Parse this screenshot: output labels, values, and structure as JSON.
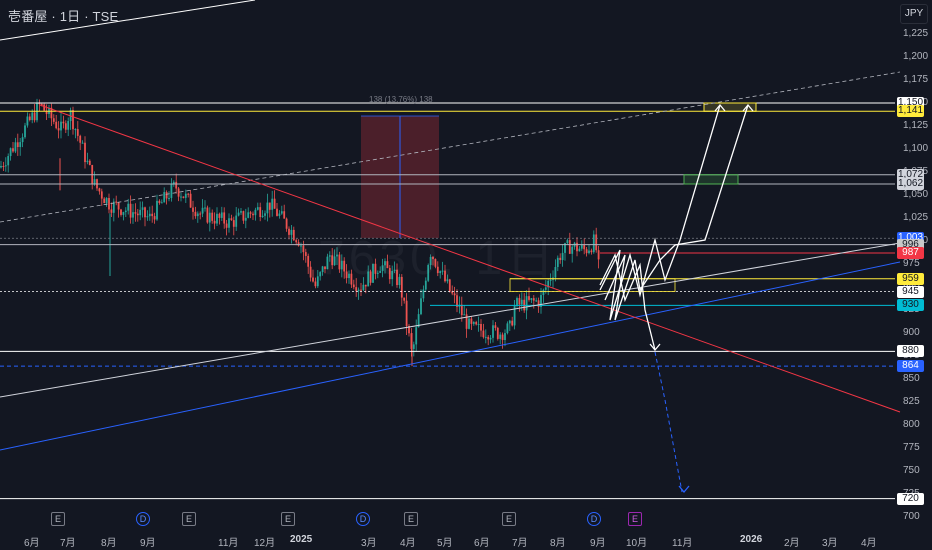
{
  "header": {
    "title": "壱番屋 · 1日 · TSE"
  },
  "currency": "JPY",
  "watermark": "7630, 1日",
  "measure_label": "138 (13.76%) 138",
  "price_axis": [
    "1,225",
    "1,200",
    "1,175",
    "1,150",
    "1,125",
    "1,100",
    "1,075",
    "1,050",
    "1,025",
    "1,000",
    "975",
    "950",
    "925",
    "900",
    "875",
    "850",
    "825",
    "800",
    "775",
    "750",
    "725",
    "700"
  ],
  "price_badges": [
    {
      "text": "1,150",
      "bg": "#ffffff",
      "fg": "#131722"
    },
    {
      "text": "1,141",
      "bg": "#ffeb3b",
      "fg": "#131722"
    },
    {
      "text": "1,072",
      "bg": "#d1d4dc",
      "fg": "#131722"
    },
    {
      "text": "1,062",
      "bg": "#d1d4dc",
      "fg": "#131722"
    },
    {
      "text": "1,003",
      "bg": "#2962ff",
      "fg": "#ffffff"
    },
    {
      "text": "996",
      "bg": "#c8c8c8",
      "fg": "#131722"
    },
    {
      "text": "987",
      "bg": "#f23645",
      "fg": "#ffffff"
    },
    {
      "text": "959",
      "bg": "#ffeb3b",
      "fg": "#131722"
    },
    {
      "text": "945",
      "bg": "#ffffff",
      "fg": "#131722"
    },
    {
      "text": "930",
      "bg": "#00bcd4",
      "fg": "#131722"
    },
    {
      "text": "880",
      "bg": "#ffffff",
      "fg": "#131722"
    },
    {
      "text": "864",
      "bg": "#2962ff",
      "fg": "#ffffff"
    },
    {
      "text": "720",
      "bg": "#ffffff",
      "fg": "#131722"
    }
  ],
  "time_axis": [
    {
      "label": "6月",
      "bold": false
    },
    {
      "label": "7月",
      "bold": false
    },
    {
      "label": "8月",
      "bold": false
    },
    {
      "label": "9月",
      "bold": false
    },
    {
      "label": "11月",
      "bold": false
    },
    {
      "label": "12月",
      "bold": false
    },
    {
      "label": "2025",
      "bold": true
    },
    {
      "label": "3月",
      "bold": false
    },
    {
      "label": "4月",
      "bold": false
    },
    {
      "label": "5月",
      "bold": false
    },
    {
      "label": "6月",
      "bold": false
    },
    {
      "label": "7月",
      "bold": false
    },
    {
      "label": "8月",
      "bold": false
    },
    {
      "label": "9月",
      "bold": false
    },
    {
      "label": "10月",
      "bold": false
    },
    {
      "label": "11月",
      "bold": false
    },
    {
      "label": "2026",
      "bold": true
    },
    {
      "label": "2月",
      "bold": false
    },
    {
      "label": "3月",
      "bold": false
    },
    {
      "label": "4月",
      "bold": false
    }
  ],
  "events": [
    {
      "type": "E",
      "label": "E"
    },
    {
      "type": "D",
      "label": "D"
    },
    {
      "type": "E",
      "label": "E"
    },
    {
      "type": "E",
      "label": "E"
    },
    {
      "type": "D",
      "label": "D"
    },
    {
      "type": "E",
      "label": "E"
    },
    {
      "type": "E",
      "label": "E"
    },
    {
      "type": "D",
      "label": "D"
    },
    {
      "type": "E2",
      "label": "E"
    }
  ],
  "colors": {
    "background": "#131722",
    "up": "#26a69a",
    "down": "#ef5350",
    "yellow": "#ffeb3b",
    "blue": "#2962ff",
    "red": "#f23645",
    "cyan": "#00bcd4",
    "white": "#ffffff"
  },
  "chart_data": {
    "type": "candlestick",
    "symbol": "7630",
    "name": "壱番屋",
    "interval": "1日",
    "exchange": "TSE",
    "currency": "JPY",
    "ylim": [
      700,
      1240
    ],
    "horizontal_levels": [
      1150,
      1141,
      1072,
      1062,
      996,
      987,
      959,
      945,
      930,
      880,
      864,
      720
    ],
    "price_path_anchors": [
      {
        "t": "2024-05",
        "price": 1080
      },
      {
        "t": "2024-06",
        "price": 1145
      },
      {
        "t": "2024-07",
        "price": 1110
      },
      {
        "t": "2024-08",
        "price": 1050
      },
      {
        "t": "2024-09",
        "price": 1020
      },
      {
        "t": "2024-10",
        "price": 1040
      },
      {
        "t": "2024-11",
        "price": 1030
      },
      {
        "t": "2024-12",
        "price": 1020
      },
      {
        "t": "2025-01",
        "price": 990
      },
      {
        "t": "2025-02",
        "price": 980
      },
      {
        "t": "2025-03",
        "price": 950
      },
      {
        "t": "2025-04",
        "price": 880
      },
      {
        "t": "2025-04",
        "price": 985
      },
      {
        "t": "2025-05",
        "price": 940
      },
      {
        "t": "2025-06",
        "price": 910
      },
      {
        "t": "2025-07",
        "price": 935
      },
      {
        "t": "2025-08",
        "price": 995
      },
      {
        "t": "2025-09",
        "price": 955
      }
    ]
  }
}
